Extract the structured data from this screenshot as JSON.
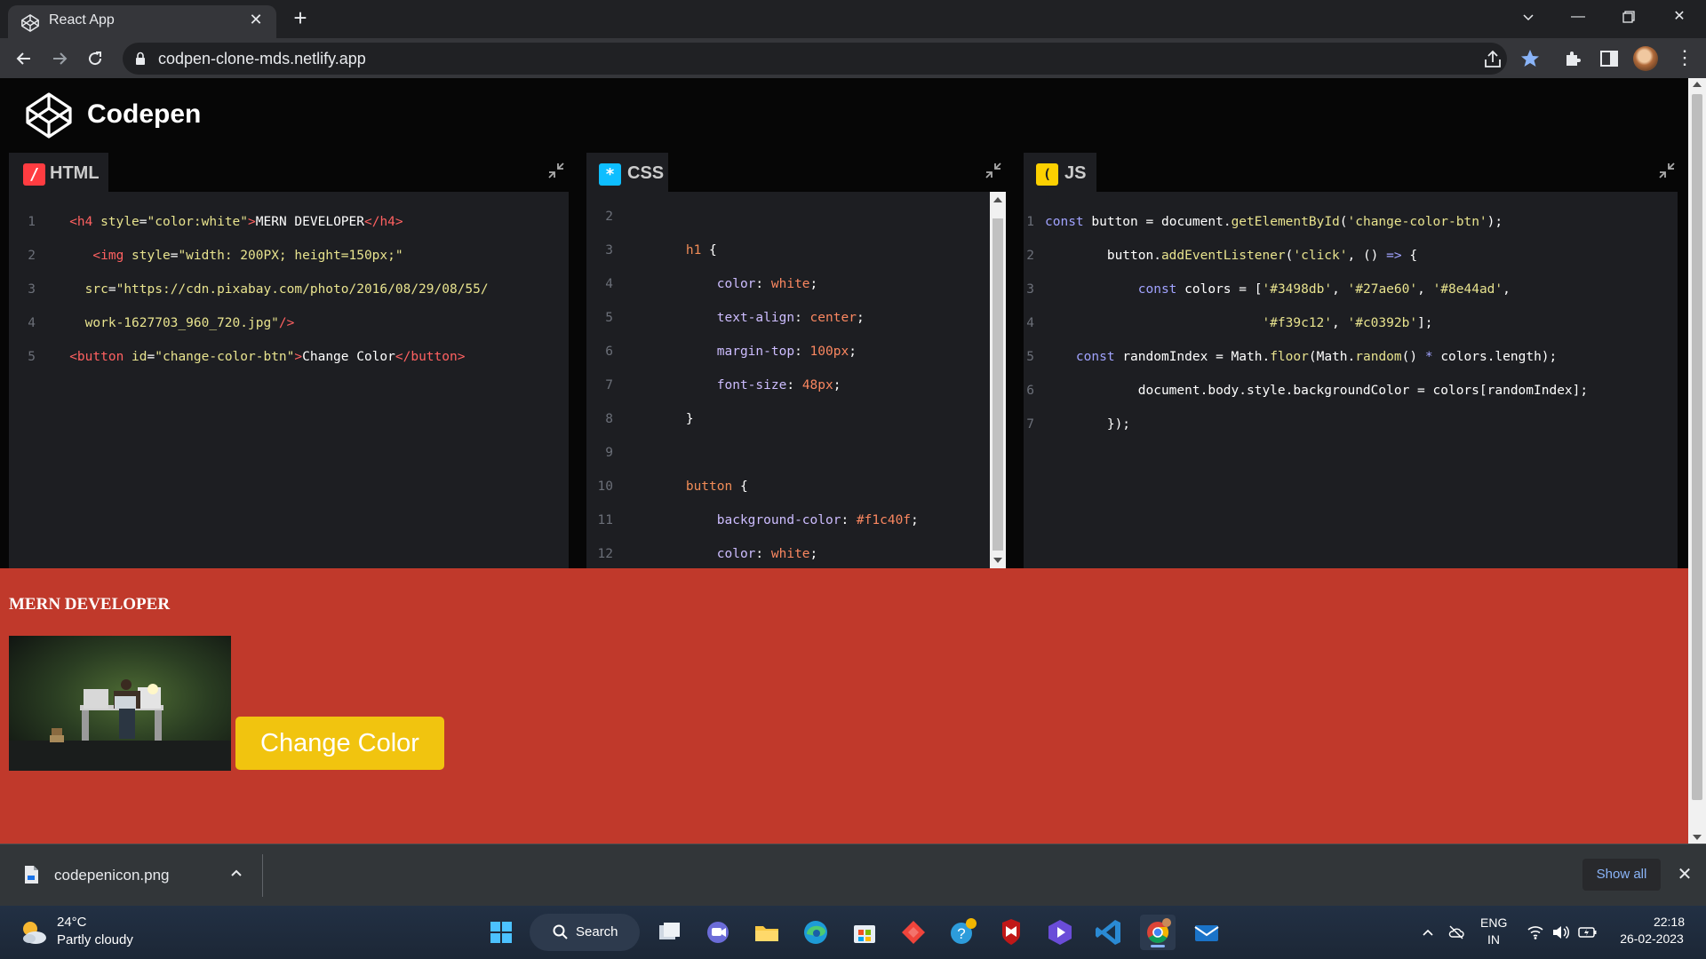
{
  "browser": {
    "tab_title": "React App",
    "url": "codpen-clone-mds.netlify.app"
  },
  "app": {
    "brand": "Codepen"
  },
  "editors": {
    "html": {
      "label": "HTML",
      "badge": "/",
      "lines": [
        "1",
        "2",
        "3",
        "4",
        "5"
      ]
    },
    "css": {
      "label": "CSS",
      "badge": "*",
      "first_line": 2
    },
    "js": {
      "label": "JS",
      "badge": "( )"
    }
  },
  "preview": {
    "heading": "MERN DEVELOPER",
    "button_label": "Change Color",
    "background": "#c0392b",
    "button_color": "#f1c40f"
  },
  "downloads": {
    "file_name": "codepenicon.png",
    "show_all": "Show all"
  },
  "taskbar": {
    "temperature": "24°C",
    "condition": "Partly cloudy",
    "search_label": "Search",
    "lang_top": "ENG",
    "lang_bottom": "IN",
    "time": "22:18",
    "date": "26-02-2023"
  }
}
